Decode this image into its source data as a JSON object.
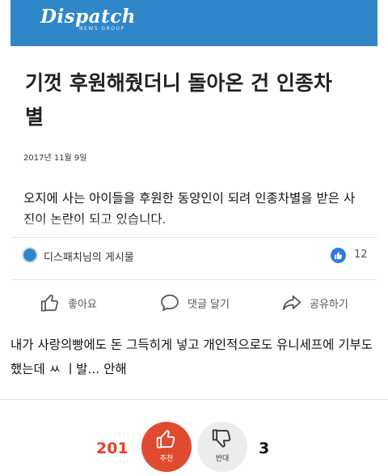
{
  "article": {
    "brand": "Dispatch",
    "brand_sub": "NEWS GROUP",
    "headline": "기껏 후원해줬더니 돌아온 건 인종차별",
    "date": "2017년 11월 9일",
    "lede": "오지에 사는 아이들을 후원한 동양인이 되려 인종차별을 받은 사진이 논란이 되고 있습니다."
  },
  "post": {
    "page_name": "디스패치님의 게시물",
    "like_count": "12"
  },
  "actions": {
    "like": "좋아요",
    "comment": "댓글 달기",
    "share": "공유하기"
  },
  "comment": {
    "text": "내가 사랑의빵에도 돈 그득히게 넣고 개인적으로도 유니세프에 기부도 했는데 ㅆ ㅣ발... 안해"
  },
  "votes": {
    "up_count": "201",
    "up_label": "추천",
    "down_label": "반대",
    "down_count": "3"
  },
  "colors": {
    "brand_blue": "#2f86c9",
    "upvote_red": "#e04a2f",
    "upvote_count_red": "#e8402c",
    "like_badge_blue": "#2f79e0"
  }
}
